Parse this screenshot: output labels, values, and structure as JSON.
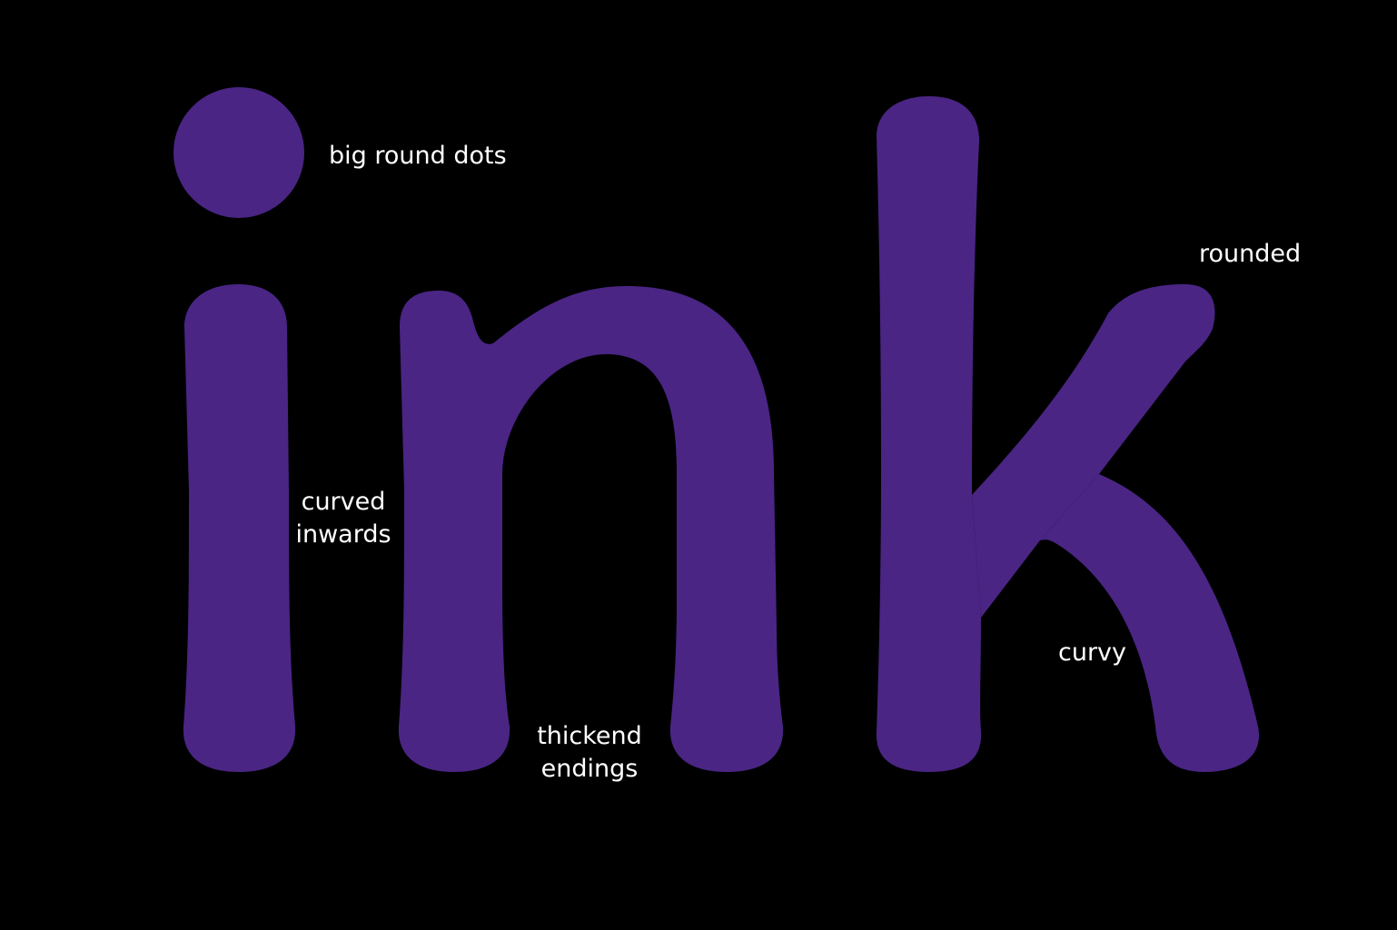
{
  "colors": {
    "background": "#000000",
    "glyph": "#4a2584",
    "label": "#ffffff"
  },
  "glyphs": {
    "letters": [
      "i",
      "n",
      "k"
    ]
  },
  "annotations": {
    "big_round_dots": "big round dots",
    "rounded": "rounded",
    "curved_inwards": [
      "curved",
      "inwards"
    ],
    "thickend_endings": [
      "thickend",
      "endings"
    ],
    "curvy": "curvy"
  }
}
